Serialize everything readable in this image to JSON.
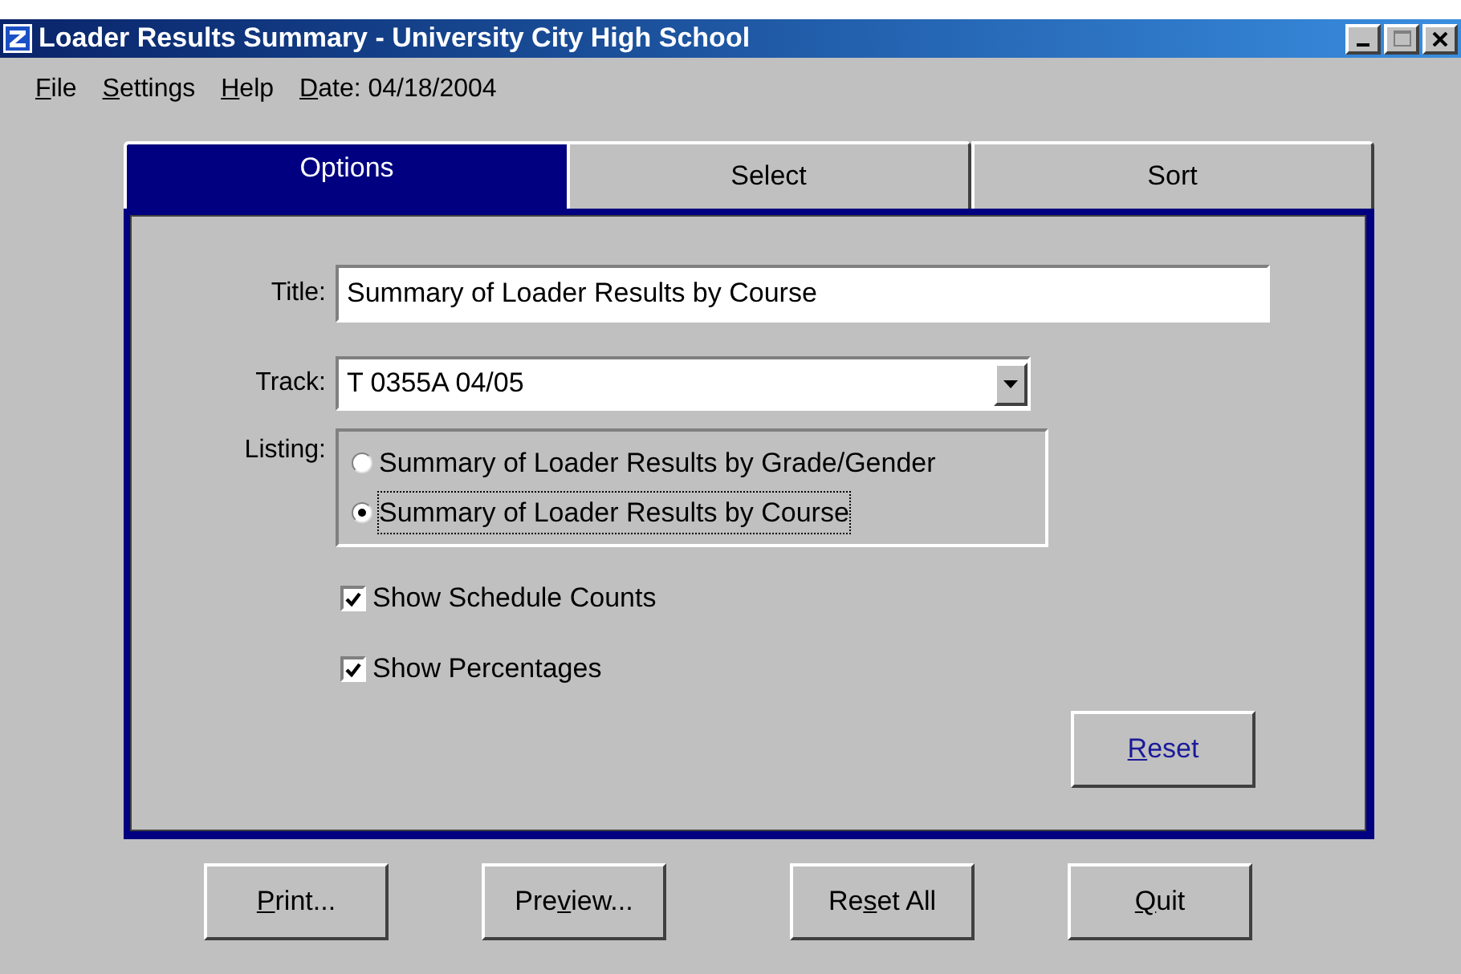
{
  "window": {
    "title": "Loader Results Summary - University City High School"
  },
  "menu": [
    {
      "parts": [
        {
          "text": "F",
          "underlined": true
        },
        {
          "text": "ile",
          "underlined": false
        }
      ]
    },
    {
      "parts": [
        {
          "text": "S",
          "underlined": true
        },
        {
          "text": "ettings",
          "underlined": false
        }
      ]
    },
    {
      "parts": [
        {
          "text": "H",
          "underlined": true
        },
        {
          "text": "elp",
          "underlined": false
        }
      ]
    },
    {
      "parts": [
        {
          "text": "D",
          "underlined": true
        },
        {
          "text": "ate: 04/18/2004",
          "underlined": false
        }
      ]
    }
  ],
  "tabs": [
    {
      "label": "Options",
      "selected": true
    },
    {
      "label": "Select",
      "selected": false
    },
    {
      "label": "Sort",
      "selected": false
    }
  ],
  "form": {
    "title_label": "Title:",
    "title_value": "Summary of Loader Results by Course",
    "track_label": "Track:",
    "track_value": "T 0355A 04/05",
    "listing_label": "Listing:",
    "listing_options": [
      {
        "label": "Summary of Loader Results by Grade/Gender",
        "selected": false
      },
      {
        "label": "Summary of Loader Results by Course",
        "selected": true
      }
    ],
    "checkboxes": [
      {
        "label": "Show Schedule Counts",
        "checked": true
      },
      {
        "label": "Show Percentages",
        "checked": true
      }
    ],
    "reset_button": {
      "parts": [
        {
          "text": "R",
          "underlined": true
        },
        {
          "text": "eset",
          "underlined": false
        }
      ]
    }
  },
  "buttons": [
    {
      "parts": [
        {
          "text": "P",
          "underlined": true
        },
        {
          "text": "rint...",
          "underlined": false
        }
      ]
    },
    {
      "parts": [
        {
          "text": "Pre",
          "underlined": false
        },
        {
          "text": "v",
          "underlined": true
        },
        {
          "text": "iew...",
          "underlined": false
        }
      ]
    },
    {
      "parts": [
        {
          "text": "Re",
          "underlined": false
        },
        {
          "text": "s",
          "underlined": true
        },
        {
          "text": "et All",
          "underlined": false
        }
      ]
    },
    {
      "parts": [
        {
          "text": "Q",
          "underlined": true
        },
        {
          "text": "uit",
          "underlined": false
        }
      ]
    }
  ]
}
